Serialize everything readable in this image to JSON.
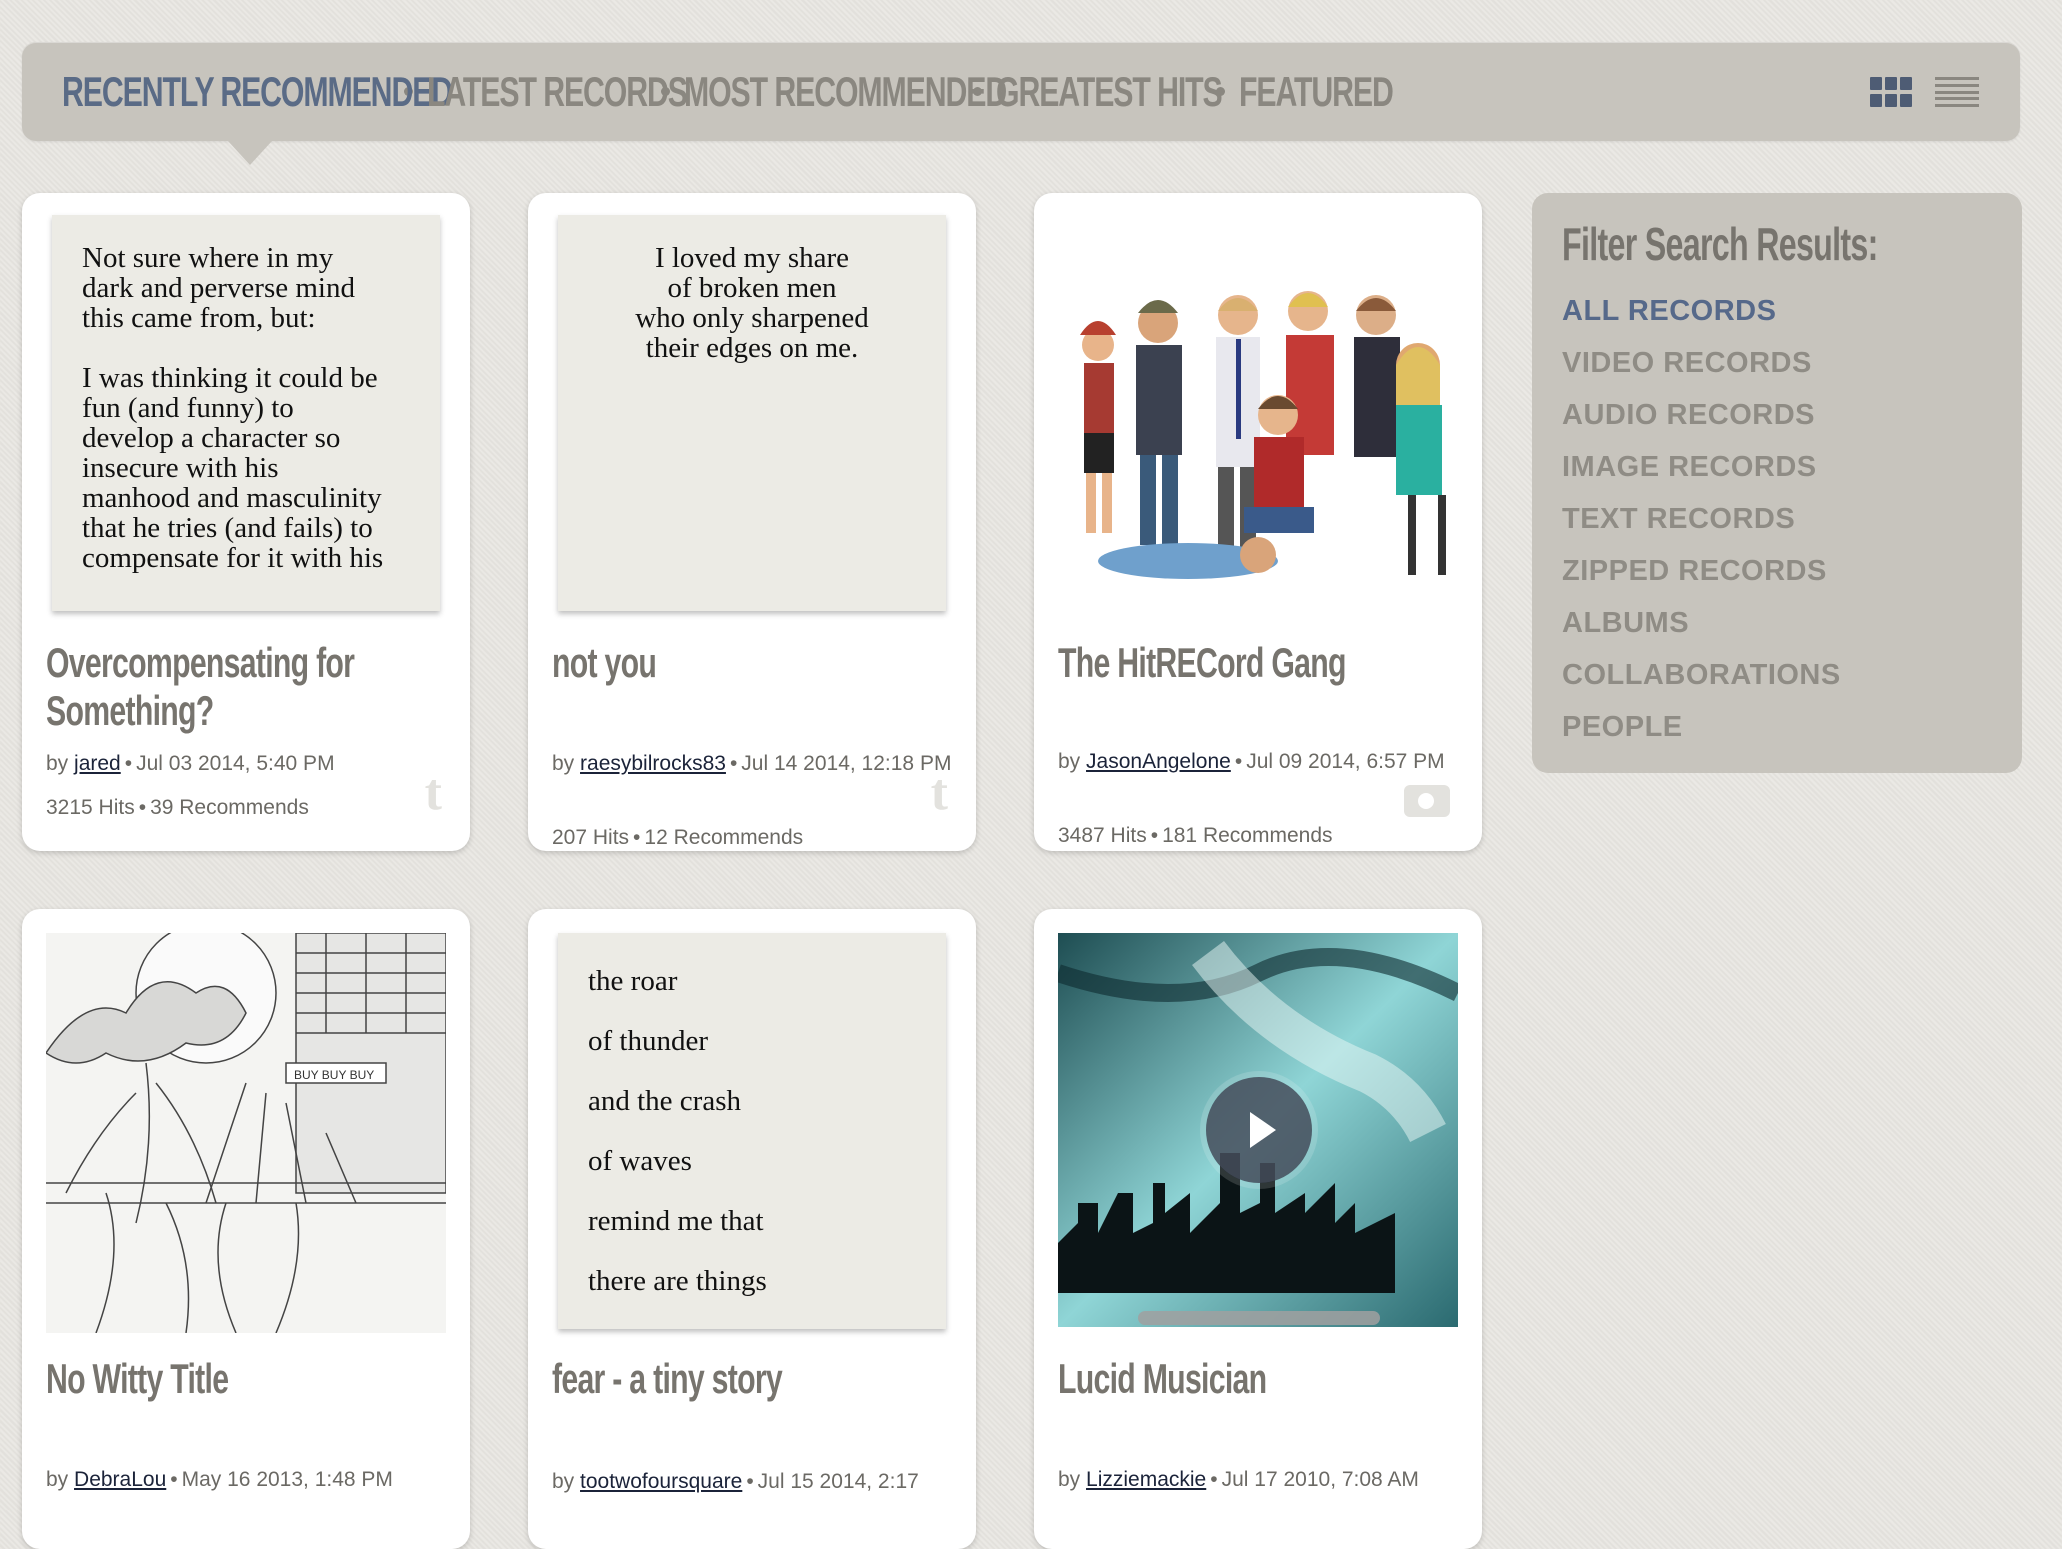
{
  "nav": {
    "tabs": [
      "RECENTLY RECOMMENDED",
      "LATEST RECORDS",
      "MOST RECOMMENDED",
      "GREATEST HITS",
      "FEATURED"
    ],
    "active_tab": "RECENTLY RECOMMENDED",
    "view_modes": [
      "grid-view",
      "list-view"
    ]
  },
  "cards": [
    {
      "title": "Overcompensating for Something?",
      "by": "by",
      "author": "jared",
      "date": "Jul 03 2014, 5:40 PM",
      "hits": "3215 Hits",
      "recommends": "39 Recommends",
      "type_icon": "text-icon",
      "preview_text": "Not sure where in my\ndark and perverse mind\nthis came from, but:\n\nI was thinking it could be\nfun (and funny) to\ndevelop a character so\ninsecure with his\nmanhood and masculinity\nthat he tries (and fails) to\ncompensate for it with his"
    },
    {
      "title": "not you",
      "by": "by",
      "author": "raesybilrocks83",
      "date": "Jul 14 2014, 12:18 PM",
      "hits": "207 Hits",
      "recommends": "12 Recommends",
      "type_icon": "text-icon",
      "preview_text": "I loved my share\nof broken men\nwho only sharpened\ntheir edges on me."
    },
    {
      "title": "The HitRECord Gang",
      "by": "by",
      "author": "JasonAngelone",
      "date": "Jul 09 2014, 6:57 PM",
      "hits": "3487 Hits",
      "recommends": "181 Recommends",
      "type_icon": "camera-icon"
    },
    {
      "title": "No Witty Title",
      "by": "by",
      "author": "DebraLou",
      "date": "May 16 2013, 1:48 PM",
      "hits": "",
      "recommends": "",
      "type_icon": "camera-icon",
      "sign_text": "BUY BUY BUY"
    },
    {
      "title": "fear - a tiny story",
      "by": "by",
      "author": "tootwofoursquare",
      "date": "Jul 15 2014, 2:17",
      "hits": "",
      "recommends": "",
      "type_icon": "text-icon",
      "preview_text": "the roar\nof thunder\nand the crash\nof waves\nremind me that\nthere are things"
    },
    {
      "title": "Lucid Musician",
      "by": "by",
      "author": "Lizziemackie",
      "date": "Jul 17 2010, 7:08 AM",
      "hits": "",
      "recommends": "",
      "type_icon": "video-icon"
    }
  ],
  "sidebar": {
    "heading": "Filter Search Results:",
    "filters": [
      "ALL RECORDS",
      "VIDEO RECORDS",
      "AUDIO RECORDS",
      "IMAGE RECORDS",
      "TEXT RECORDS",
      "ZIPPED RECORDS",
      "ALBUMS",
      "COLLABORATIONS",
      "PEOPLE"
    ],
    "active_filter": "ALL RECORDS"
  },
  "colors": {
    "active": "#5a6b86",
    "inactive": "#8a8780",
    "panel": "#c7c4bd",
    "background": "#e6e4df"
  }
}
